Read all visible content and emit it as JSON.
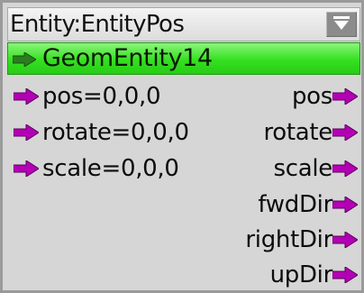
{
  "node": {
    "title": "Entity:EntityPos",
    "menu_icon": "dropdown-triangle-icon",
    "entity_label": "GeomEntity14",
    "entity_color": "#35e020",
    "port_color": "#b400b4",
    "entity_arrow_color": "#2b7d20",
    "inputs": [
      {
        "label": "pos=0,0,0"
      },
      {
        "label": "rotate=0,0,0"
      },
      {
        "label": "scale=0,0,0"
      }
    ],
    "outputs": [
      {
        "label": "pos"
      },
      {
        "label": "rotate"
      },
      {
        "label": "scale"
      },
      {
        "label": "fwdDir"
      },
      {
        "label": "rightDir"
      },
      {
        "label": "upDir"
      }
    ]
  }
}
